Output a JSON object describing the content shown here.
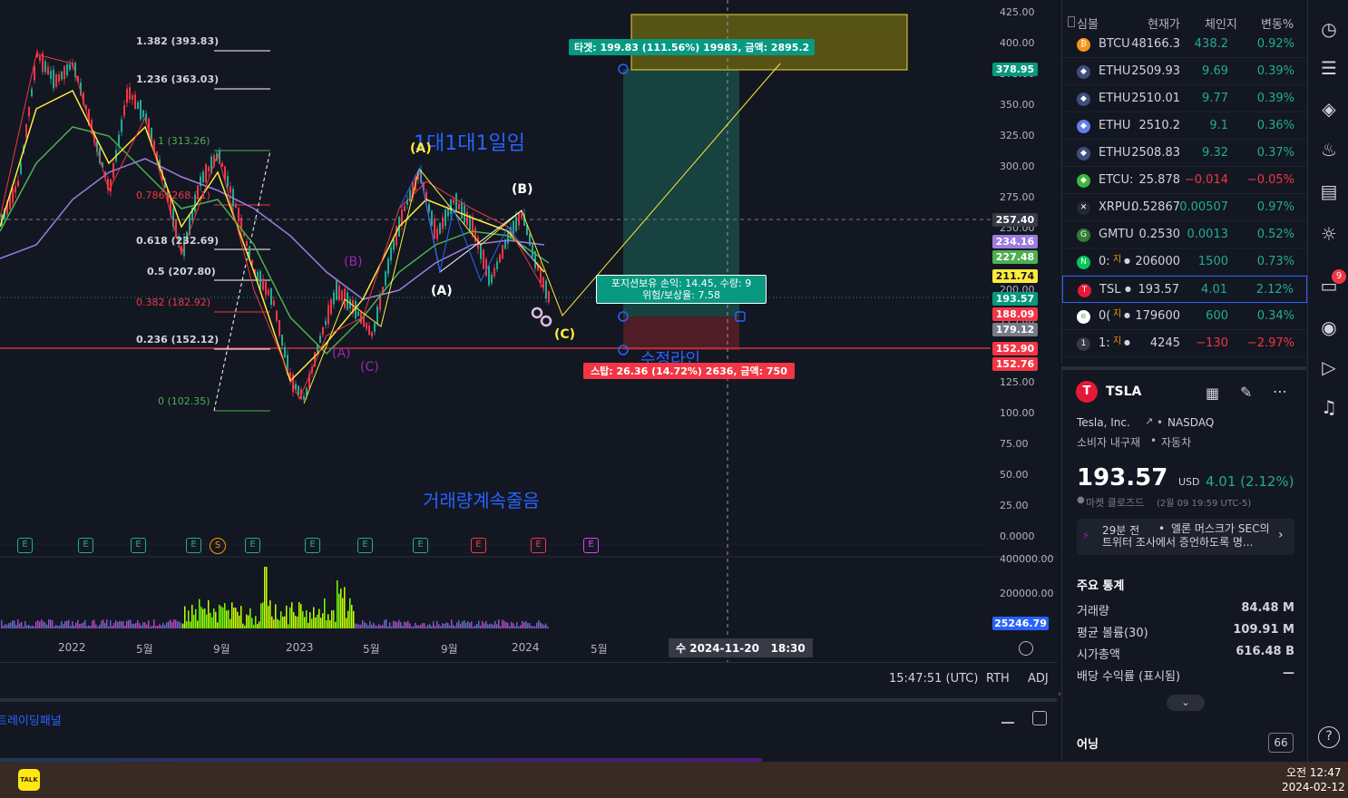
{
  "chart": {
    "price_axis": [
      "425.00",
      "400.00",
      "375.00",
      "350.00",
      "325.00",
      "300.00",
      "275.00",
      "250.00",
      "225.00",
      "200.00",
      "175.00",
      "150.00",
      "125.00",
      "100.00",
      "75.00",
      "50.00",
      "25.00",
      "0.0000"
    ],
    "volume_axis": [
      "400000.00",
      "200000.00"
    ],
    "volume_tag": "25246.79",
    "time_axis": [
      "2022",
      "5월",
      "9월",
      "2023",
      "5월",
      "9월",
      "2024",
      "5월"
    ],
    "crosshair_time": "수 2024-11-20   18:30",
    "price_tags": [
      {
        "label": "378.95",
        "bg": "#089981",
        "fg": "#ffffff"
      },
      {
        "label": "257.40",
        "bg": "#363a45",
        "fg": "#ffffff"
      },
      {
        "label": "234.16",
        "bg": "#9c7ce0",
        "fg": "#ffffff"
      },
      {
        "label": "227.48",
        "bg": "#4caf50",
        "fg": "#ffffff"
      },
      {
        "label": "211.74",
        "bg": "#ffeb3b",
        "fg": "#131722"
      },
      {
        "label": "193.57",
        "bg": "#089981",
        "fg": "#ffffff"
      },
      {
        "label": "188.09",
        "bg": "#f23645",
        "fg": "#ffffff"
      },
      {
        "label": "179.12",
        "bg": "#787b86",
        "fg": "#ffffff"
      },
      {
        "label": "152.90",
        "bg": "#f23645",
        "fg": "#ffffff"
      },
      {
        "label": "152.76",
        "bg": "#f23645",
        "fg": "#ffffff"
      }
    ],
    "fib_labels": [
      {
        "text": "1.382 (393.83)",
        "color": "#ffffff"
      },
      {
        "text": "1.236 (363.03)",
        "color": "#ffffff"
      },
      {
        "text": "1 (313.26)",
        "color": "#4caf50"
      },
      {
        "text": "0.786 (268.11)",
        "color": "#f23645"
      },
      {
        "text": "0.618 (232.69)",
        "color": "#ffffff"
      },
      {
        "text": "0.5 (207.80)",
        "color": "#ffffff"
      },
      {
        "text": "0.382 (182.92)",
        "color": "#f23645"
      },
      {
        "text": "0.236 (152.12)",
        "color": "#ffffff"
      },
      {
        "text": "0 (102.35)",
        "color": "#4caf50"
      }
    ],
    "annotations": {
      "one_to_one": "1대1대1일임",
      "volume_note": "거래량계속줄음",
      "support_line": "수정라인",
      "wave_A_yellow": "(A)",
      "wave_B_white": "(B)",
      "wave_A_white": "(A)",
      "wave_B_purple": "(B)",
      "wave_A_purple": "(A)",
      "wave_C_purple": "(C)",
      "wave_C_yellow": "(C)"
    },
    "target_box": "타겟: 199.83 (111.56%) 19983, 금액: 2895.2",
    "position_box_1": "포지션보유 손익: 14.45, 수량: 9",
    "position_box_2": "위험/보상율: 7.58",
    "stop_box": "스탑: 26.36 (14.72%) 2636, 금액: 750",
    "earnings_badges": [
      "E",
      "E",
      "E",
      "E",
      "S",
      "E",
      "E",
      "E",
      "E",
      "E",
      "E",
      "E"
    ]
  },
  "status_bar": {
    "clock": "15:47:51 (UTC)",
    "rth": "RTH",
    "adj": "ADJ"
  },
  "trading_panel": {
    "title": "트레이딩패널"
  },
  "watchlist": {
    "headers": {
      "symbol": "심볼",
      "price": "현재가",
      "change": "체인지",
      "pct": "변동%"
    },
    "rows": [
      {
        "symbol": "BTCU",
        "price": "48166.3",
        "change": "438.2",
        "pct": "0.92%",
        "dir": "pos",
        "icon_color": "#f7931a",
        "icon": "₿"
      },
      {
        "symbol": "ETHU",
        "price": "2509.93",
        "change": "9.69",
        "pct": "0.39%",
        "dir": "pos",
        "icon_color": "#3d4f7a",
        "icon": "◆"
      },
      {
        "symbol": "ETHU",
        "price": "2510.01",
        "change": "9.77",
        "pct": "0.39%",
        "dir": "pos",
        "icon_color": "#3d4f7a",
        "icon": "◆"
      },
      {
        "symbol": "ETHU",
        "price": "2510.2",
        "change": "9.1",
        "pct": "0.36%",
        "dir": "pos",
        "icon_color": "#627eea",
        "icon": "◆"
      },
      {
        "symbol": "ETHU",
        "price": "2508.83",
        "change": "9.32",
        "pct": "0.37%",
        "dir": "pos",
        "icon_color": "#3d4f7a",
        "icon": "◆"
      },
      {
        "symbol": "ETCU:",
        "price": "25.878",
        "change": "−0.014",
        "pct": "−0.05%",
        "dir": "neg",
        "icon_color": "#3ab83a",
        "icon": "◆"
      },
      {
        "symbol": "XRPU:",
        "price": "0.52867",
        "change": "0.00507",
        "pct": "0.97%",
        "dir": "pos",
        "icon_color": "#23292f",
        "icon": "✕"
      },
      {
        "symbol": "GMTU",
        "price": "0.2530",
        "change": "0.0013",
        "pct": "0.52%",
        "dir": "pos",
        "icon_color": "#2e7d32",
        "icon": "G"
      },
      {
        "symbol": "0:",
        "price": "206000",
        "change": "1500",
        "pct": "0.73%",
        "dir": "pos",
        "icon_color": "#03c75a",
        "icon": "N",
        "tag": "지"
      },
      {
        "symbol": "TSL",
        "price": "193.57",
        "change": "4.01",
        "pct": "2.12%",
        "dir": "pos",
        "icon_color": "#e31937",
        "icon": "T",
        "selected": true
      },
      {
        "symbol": "0(",
        "price": "179600",
        "change": "600",
        "pct": "0.34%",
        "dir": "pos",
        "icon_color": "#ffffff",
        "icon": "e",
        "tag": "지"
      },
      {
        "symbol": "1:",
        "price": "4245",
        "change": "−130",
        "pct": "−2.97%",
        "dir": "neg",
        "icon_color": "#363a45",
        "icon": "1",
        "tag": "지"
      }
    ]
  },
  "details": {
    "ticker": "TSLA",
    "company": "Tesla, Inc.",
    "exchange": "NASDAQ",
    "sector": "소비자 내구재",
    "industry": "자동차",
    "price": "193.57",
    "currency": "USD",
    "change": "4.01 (2.12%)",
    "market_status": "마켓 클로즈드",
    "market_time": "(2월 09 19:59 UTC-5)",
    "news_time": "29분 전",
    "news_text": "엘론 머스크가 SEC의 트위터 조사에서 증언하도록 명...",
    "stats_title": "주요 통계",
    "stats": [
      {
        "label": "거래량",
        "value": "84.48 M"
      },
      {
        "label": "평균 볼륨(30)",
        "value": "109.91 M"
      },
      {
        "label": "시가총액",
        "value": "616.48 B"
      },
      {
        "label": "배당 수익률 (표시됨)",
        "value": "—"
      }
    ],
    "earnings_title": "어닝",
    "earnings_badge": "66"
  },
  "toolbar": {
    "notification_count": "9"
  },
  "taskbar": {
    "time": "오전 12:47",
    "date": "2024-02-12",
    "app_icon": "TALK"
  }
}
